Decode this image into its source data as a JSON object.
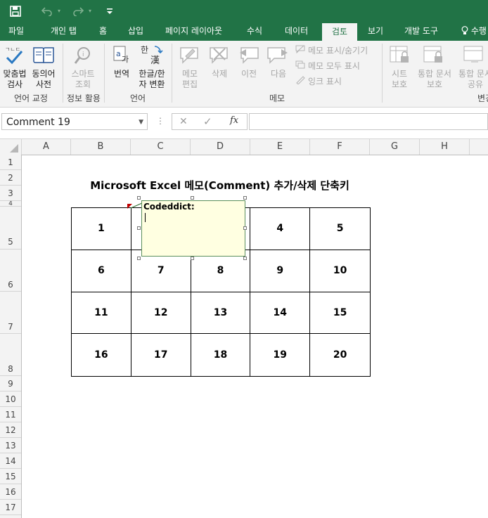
{
  "titlebar": {
    "icons": [
      "save-icon",
      "undo-icon",
      "redo-icon",
      "customize-quick-access-icon"
    ]
  },
  "tabs": [
    {
      "label": "파일"
    },
    {
      "label": "개인 탭"
    },
    {
      "label": "홈"
    },
    {
      "label": "삽입"
    },
    {
      "label": "페이지 레이아웃"
    },
    {
      "label": "수식"
    },
    {
      "label": "데이터"
    },
    {
      "label": "검토",
      "active": true
    },
    {
      "label": "보기"
    },
    {
      "label": "개발 도구"
    },
    {
      "label": "수행"
    }
  ],
  "ribbon": {
    "proofing": {
      "spell_check": "맞춤법\n검사",
      "dictionary": "동의어\n사전",
      "group_label": "언어 교정"
    },
    "insights": {
      "smart_lookup": "스마트\n조회",
      "group_label": "정보 활용"
    },
    "language": {
      "translate": "번역",
      "hanja": "한글/한\n자 변환",
      "group_label": "언어"
    },
    "comments": {
      "edit": "메모\n편집",
      "delete": "삭제",
      "previous": "이전",
      "next": "다음",
      "show_hide": "메모 표시/숨기기",
      "show_all": "메모 모두 표시",
      "show_ink": "잉크 표시",
      "group_label": "메모"
    },
    "changes": {
      "protect_sheet": "시트\n보호",
      "protect_workbook": "통합 문서\n보호",
      "share": "통합 문서\n공유",
      "group_label": "변경"
    }
  },
  "formula_bar": {
    "name_box": "Comment 19",
    "formula": ""
  },
  "columns": [
    "A",
    "B",
    "C",
    "D",
    "E",
    "F",
    "G",
    "H"
  ],
  "rows": [
    "1",
    "2",
    "3",
    "4",
    "5",
    "6",
    "7",
    "8",
    "9",
    "10",
    "11",
    "12",
    "13",
    "14",
    "15",
    "16",
    "17"
  ],
  "sheet": {
    "title": "Microsoft Excel 메모(Comment) 추가/삭제 단축키",
    "grid": [
      [
        "1",
        "2",
        "3",
        "4",
        "5"
      ],
      [
        "6",
        "7",
        "8",
        "9",
        "10"
      ],
      [
        "11",
        "12",
        "13",
        "14",
        "15"
      ],
      [
        "16",
        "17",
        "18",
        "19",
        "20"
      ]
    ]
  },
  "comment": {
    "author": "Codeddict:",
    "text": ""
  },
  "colors": {
    "excel_green": "#217346",
    "ribbon_bg": "#f3f3f3",
    "comment_bg": "#ffffe1"
  }
}
